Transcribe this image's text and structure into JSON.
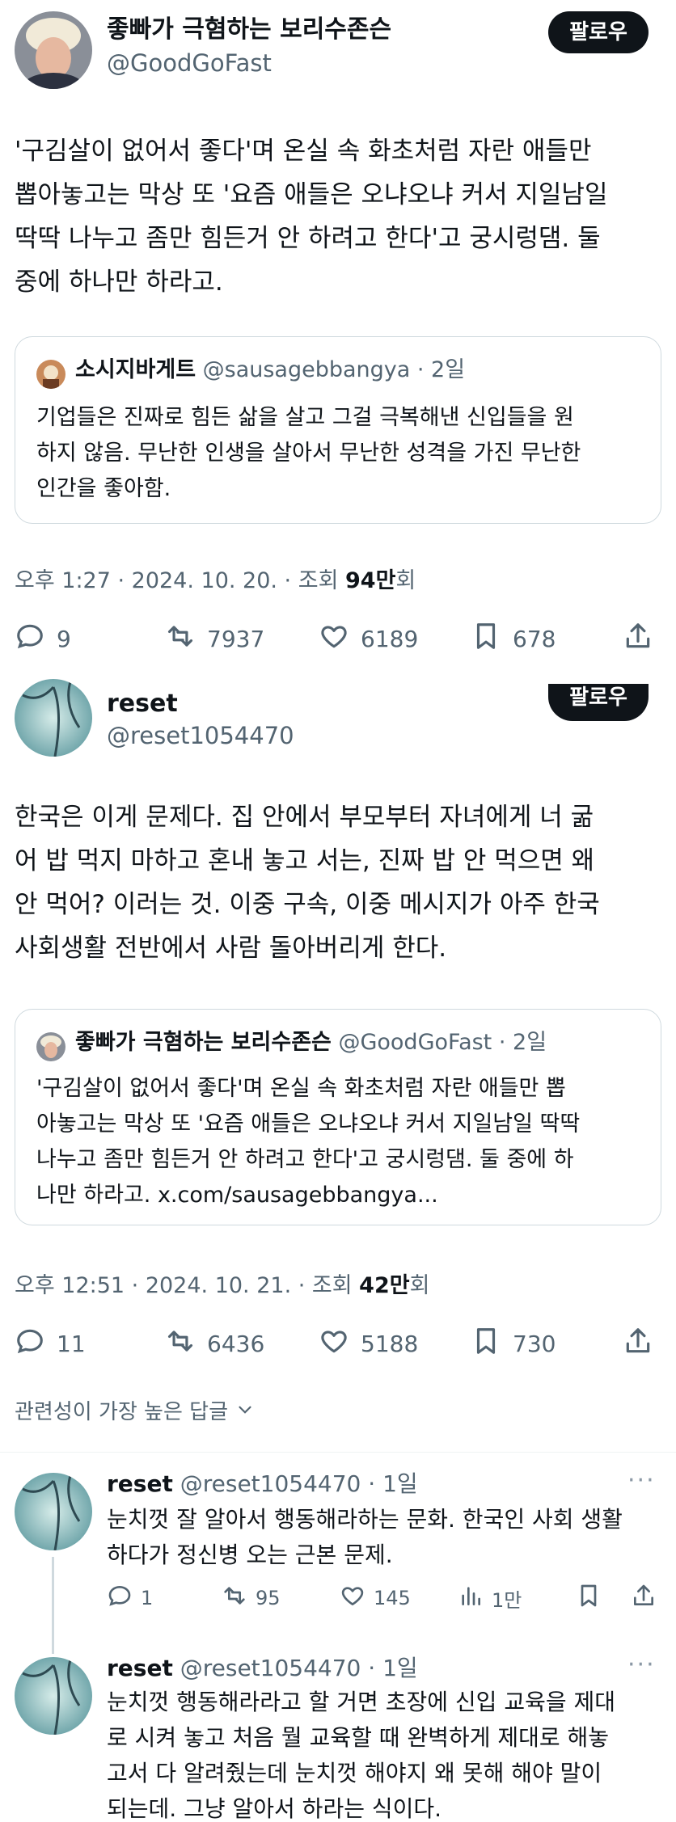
{
  "post1": {
    "author_name": "좋빠가 극혐하는 보리수존슨",
    "author_handle": "@GoodGoFast",
    "follow_label": "팔로우",
    "text": "'구김살이 없어서 좋다'며 온실 속 화초처럼 자란 애들만\n뽑아놓고는 막상 또 '요즘 애들은 오냐오냐 커서 지일남일\n딱딱 나누고 좀만 힘든거 안 하려고 한다'고 궁시렁댐. 둘\n중에 하나만 하라고.",
    "quote": {
      "name": "소시지바게트",
      "meta": " @sausagebbangya · 2일",
      "text": "기업들은 진짜로 힘든 삶을 살고 그걸 극복해낸 신입들을 원\n하지 않음. 무난한 인생을 살아서 무난한 성격을 가진 무난한\n인간을 좋아함."
    },
    "meta_prefix": "오후 1:27 · 2024. 10. 20. · 조회 ",
    "views": "94만",
    "meta_suffix": "회",
    "stats": {
      "replies": "9",
      "retweets": "7937",
      "likes": "6189",
      "bookmarks": "678"
    }
  },
  "post2": {
    "author_name": "reset",
    "author_handle": "@reset1054470",
    "follow_label": "팔로우",
    "text": "한국은 이게 문제다. 집 안에서 부모부터 자녀에게 너 굶\n어 밥 먹지 마하고 혼내 놓고 서는, 진짜 밥 안 먹으면 왜\n안 먹어? 이러는 것. 이중 구속, 이중 메시지가 아주 한국\n사회생활 전반에서 사람 돌아버리게 한다.",
    "quote": {
      "name": "좋빠가 극혐하는 보리수존슨",
      "meta": " @GoodGoFast · 2일",
      "text": "'구김살이 없어서 좋다'며 온실 속 화초처럼 자란 애들만 뽑\n아놓고는 막상 또 '요즘 애들은 오냐오냐 커서 지일남일 딱딱\n나누고 좀만 힘든거 안 하려고 한다'고 궁시렁댐. 둘 중에 하\n나만 하라고. x.com/sausagebbangya..."
    },
    "meta_prefix": "오후 12:51 · 2024. 10. 21. · 조회 ",
    "views": "42만",
    "meta_suffix": "회",
    "stats": {
      "replies": "11",
      "retweets": "6436",
      "likes": "5188",
      "bookmarks": "730"
    }
  },
  "sort_label": "관련성이 가장 높은 답글",
  "replies": [
    {
      "name": "reset",
      "meta": " @reset1054470 · 1일",
      "text": "눈치껏 잘 알아서 행동해라하는 문화. 한국인 사회 생활\n하다가 정신병 오는 근본 문제.",
      "stats": {
        "replies": "1",
        "retweets": "95",
        "likes": "145",
        "views": "1만"
      }
    },
    {
      "name": "reset",
      "meta": " @reset1054470 · 1일",
      "text": "눈치껏 행동해라라고 할 거면 초장에 신입 교육을 제대\n로 시켜 놓고 처음 뭘 교육할 때 완벽하게 제대로 해놓\n고서 다 알려줬는데 눈치껏 해야지 왜 못해 해야 말이\n되는데. 그냥 알아서 하라는 식이다."
    }
  ],
  "more_label": "···",
  "colors": {
    "text": "#0f1419",
    "secondary": "#536471",
    "border": "#cfd9de",
    "button": "#0f1419"
  }
}
